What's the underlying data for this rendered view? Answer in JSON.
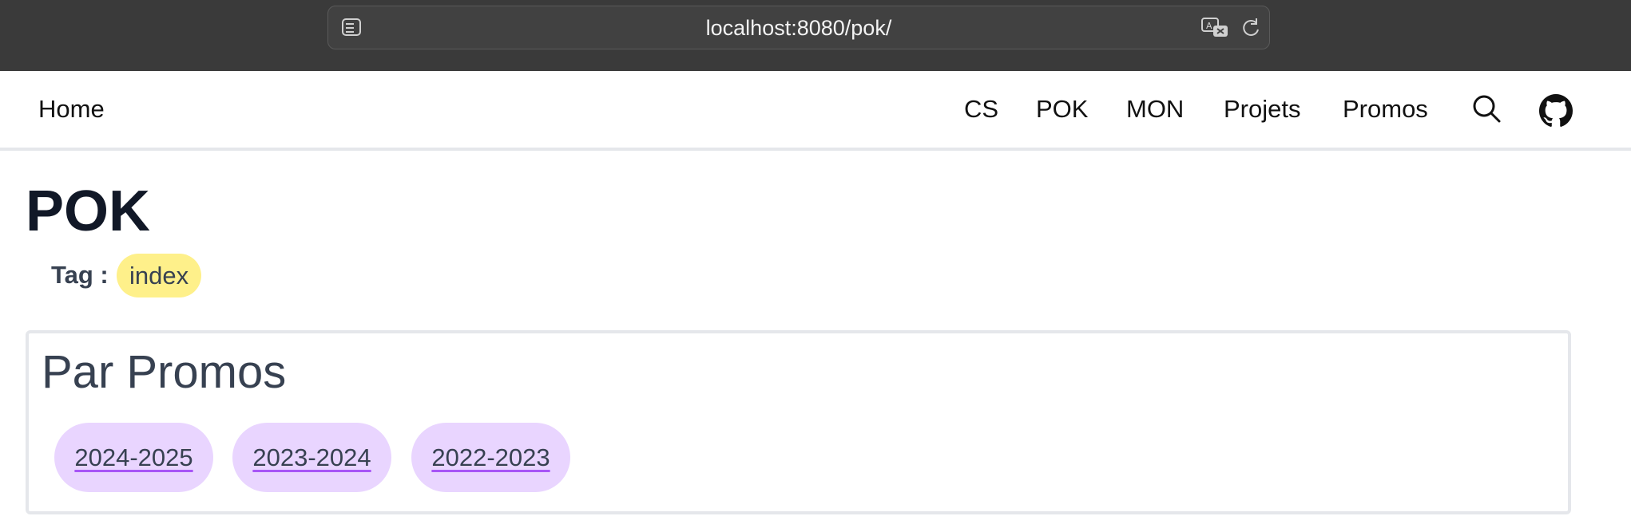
{
  "browser": {
    "url": "localhost:8080/pok/"
  },
  "header": {
    "home_label": "Home",
    "nav": [
      "CS",
      "POK",
      "MON",
      "Projets",
      "Promos"
    ]
  },
  "page": {
    "title": "POK",
    "tag_label": "Tag :",
    "tag_value": "index"
  },
  "promos_card": {
    "title": "Par Promos",
    "promos": [
      "2024-2025",
      "2023-2024",
      "2022-2023"
    ]
  },
  "colors": {
    "tag_bg": "#fef08a",
    "promo_bg": "#e9d5ff",
    "promo_underline": "#a855f7"
  },
  "icons": [
    "sidebar-icon",
    "translate-icon",
    "reload-icon",
    "search-icon",
    "github-icon"
  ]
}
